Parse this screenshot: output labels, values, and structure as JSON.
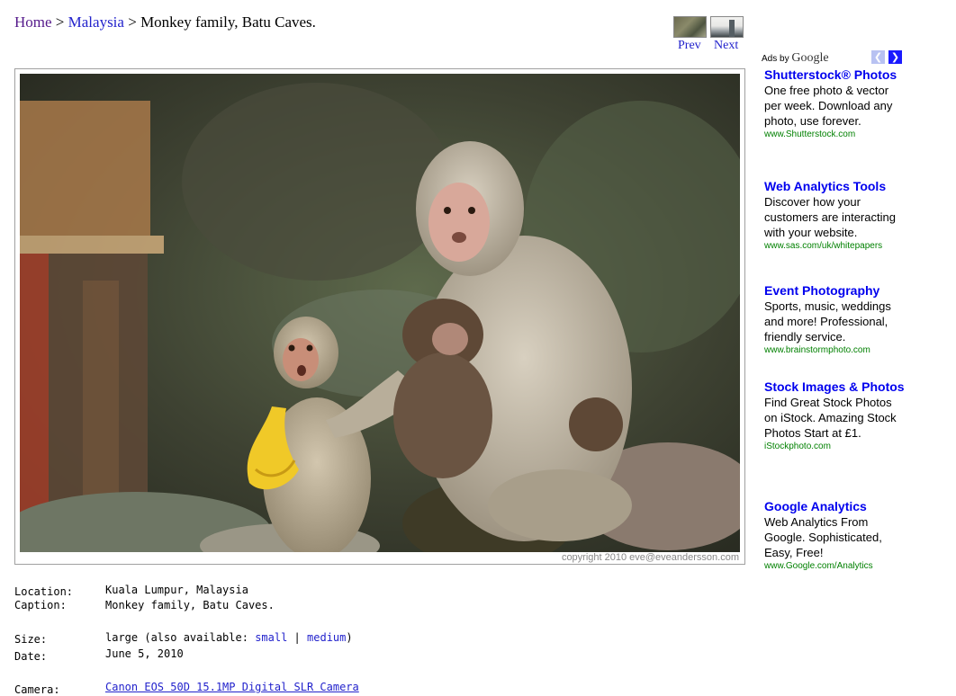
{
  "breadcrumb": {
    "home": "Home",
    "sep1": ">",
    "country": "Malaysia",
    "sep2": ">",
    "current": "Monkey family, Batu Caves."
  },
  "nav": {
    "prev": "Prev",
    "next": "Next"
  },
  "photo": {
    "copyright": "copyright 2010 eve@eveandersson.com"
  },
  "details": {
    "location_label": "Location:",
    "location": "Kuala Lumpur, Malaysia",
    "caption_label": "Caption:",
    "caption": "Monkey family, Batu Caves.",
    "size_label": "Size:",
    "size_prefix": "large (also available:",
    "size_small": "small",
    "size_sep": "|",
    "size_medium": "medium",
    "size_suffix": ")",
    "date_label": "Date:",
    "date": "June 5, 2010",
    "camera_label": "Camera:",
    "camera": "Canon EOS 50D 15.1MP Digital SLR Camera"
  },
  "ads": {
    "ads_by": "Ads by",
    "google": "Google",
    "items": [
      {
        "title": "Shutterstock® Photos",
        "desc": "One free photo & vector per week. Download any photo, use forever.",
        "url": "www.Shutterstock.com"
      },
      {
        "title": "Web Analytics Tools",
        "desc": "Discover how your customers are interacting with your website.",
        "url": "www.sas.com/uk/whitepapers"
      },
      {
        "title": "Event Photography",
        "desc": "Sports, music, weddings and more! Professional, friendly service.",
        "url": "www.brainstormphoto.com"
      },
      {
        "title": "Stock Images & Photos",
        "desc": "Find Great Stock Photos on iStock. Amazing Stock Photos Start at £1.",
        "url": "iStockphoto.com"
      },
      {
        "title": "Google Analytics",
        "desc": "Web Analytics From Google. Sophisticated, Easy, Free!",
        "url": "www.Google.com/Analytics"
      }
    ]
  }
}
